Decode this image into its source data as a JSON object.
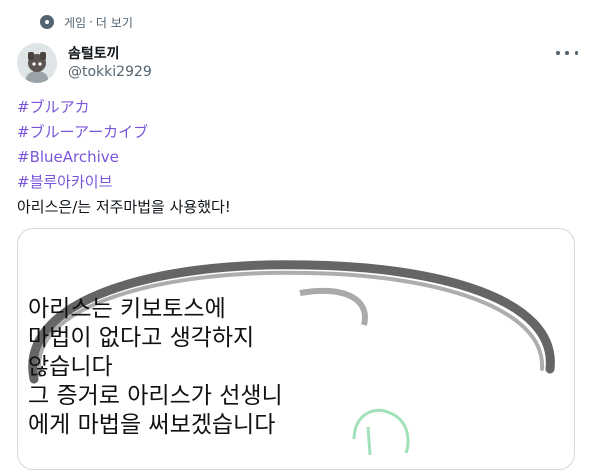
{
  "context": {
    "icon": "pin-marker-icon",
    "label": "게임",
    "separator": "·",
    "more_link": "더 보기"
  },
  "author": {
    "display_name": "솜털토끼",
    "handle": "@tokki2929",
    "avatar": "avatar-image"
  },
  "tweet": {
    "hashtags": [
      "#ブルアカ",
      "#ブルーアーカイブ",
      "#BlueArchive",
      "#블루아카이브"
    ],
    "text": "아리스은/는 저주마법을 사용했다!"
  },
  "media": {
    "caption_lines": [
      "아리스는 키보토스에",
      "마법이 없다고 생각하지",
      "않습니다",
      "그 증거로 아리스가 선생니",
      "에게 마법을 써보겠습니다"
    ]
  },
  "colors": {
    "hashtag": "#7b55d9",
    "muted": "#536471",
    "text": "#0f1419",
    "border": "#cfd9de"
  }
}
